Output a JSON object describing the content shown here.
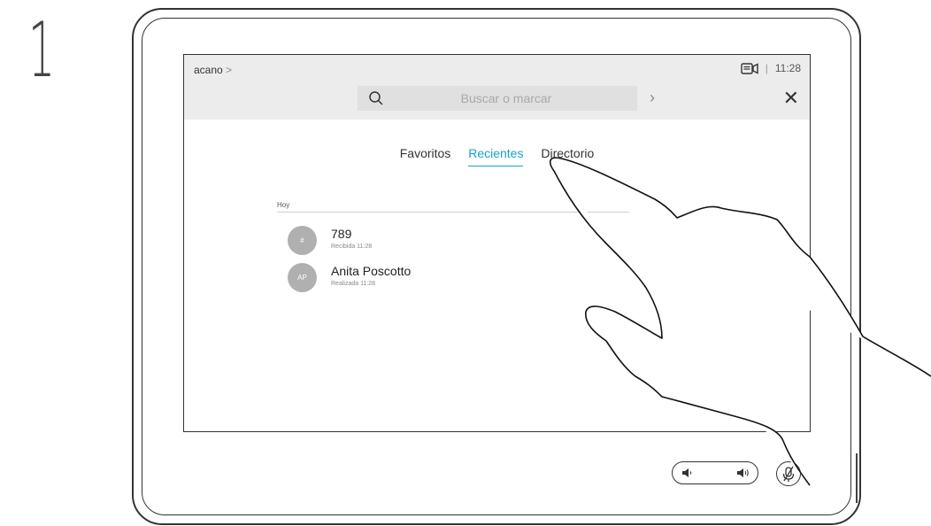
{
  "step": {
    "number": "1"
  },
  "header": {
    "brand": "acano",
    "brand_chevron": ">",
    "camera_icon": "camera-self-view-icon",
    "separator": "|",
    "time": "11:28"
  },
  "search": {
    "placeholder": "Buscar o marcar",
    "search_icon": "search-icon",
    "go_icon": "chevron-right-icon",
    "close_icon": "close-icon"
  },
  "tabs": [
    {
      "label": "Favoritos",
      "active": false
    },
    {
      "label": "Recientes",
      "active": true
    },
    {
      "label": "Directorio",
      "active": false
    }
  ],
  "recents": {
    "group_label": "Hoy",
    "entries": [
      {
        "initials": "#",
        "name": "789",
        "detail": "Recibida 11:28"
      },
      {
        "initials": "AP",
        "name": "Anita Poscotto",
        "detail": "Realizada 11:28"
      }
    ]
  },
  "controls": {
    "volume_down_icon": "volume-down-icon",
    "volume_up_icon": "volume-up-icon",
    "mute_icon": "microphone-mute-icon"
  },
  "colors": {
    "accent": "#17a2c9",
    "topbar_bg": "#ececec",
    "avatar_bg": "#b0b0b0"
  }
}
